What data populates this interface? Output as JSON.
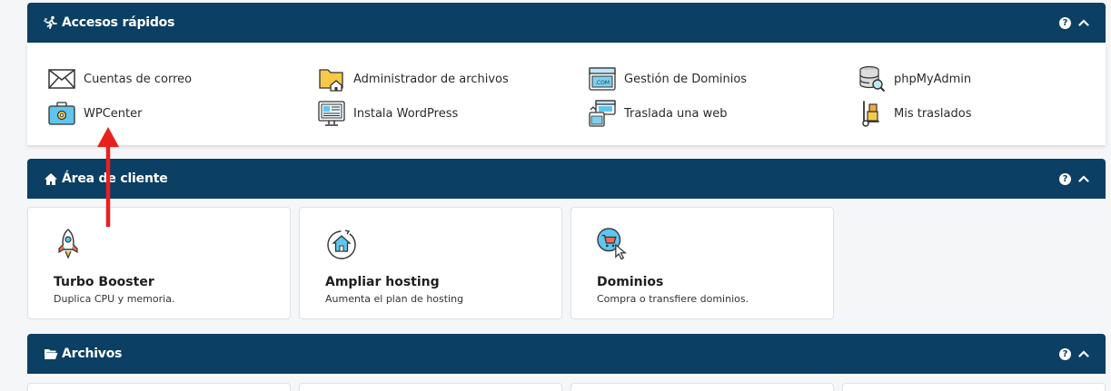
{
  "quick_access": {
    "title": "Accesos rápidos",
    "items": [
      {
        "label": "Cuentas de correo",
        "icon": "envelope-icon"
      },
      {
        "label": "Administrador de archivos",
        "icon": "folder-icon"
      },
      {
        "label": "Gestión de Dominios",
        "icon": "dotcom-icon"
      },
      {
        "label": "phpMyAdmin",
        "icon": "database-icon"
      },
      {
        "label": "WPCenter",
        "icon": "gear-briefcase-icon"
      },
      {
        "label": "Instala WordPress",
        "icon": "monitor-icon"
      },
      {
        "label": "Traslada una web",
        "icon": "migration-icon"
      },
      {
        "label": "Mis traslados",
        "icon": "hand-truck-icon"
      }
    ]
  },
  "client_area": {
    "title": "Área de cliente",
    "cards": [
      {
        "title": "Turbo Booster",
        "desc": "Duplica CPU y memoria.",
        "icon": "rocket-icon"
      },
      {
        "title": "Ampliar hosting",
        "desc": "Aumenta el plan de hosting",
        "icon": "house-cycle-icon"
      },
      {
        "title": "Dominios",
        "desc": "Compra o transfiere dominios.",
        "icon": "cart-cursor-icon"
      }
    ]
  },
  "files": {
    "title": "Archivos"
  },
  "help_glyph": "?",
  "colors": {
    "header_bg": "#0b3f63",
    "accent": "#1a9ad6",
    "arrow": "#e8201d"
  }
}
